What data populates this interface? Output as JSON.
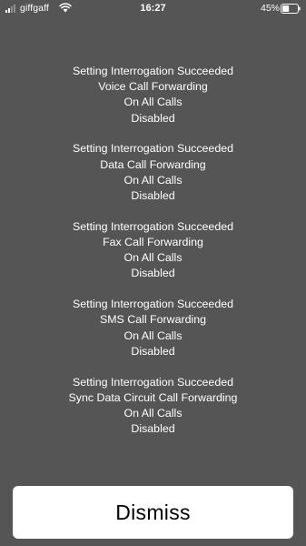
{
  "status_bar": {
    "carrier": "giffgaff",
    "time": "16:27",
    "battery_percent": "45%",
    "signal_bars": 2,
    "signal_max": 4,
    "battery_level": 0.45
  },
  "message_blocks": [
    {
      "status": "Setting Interrogation Succeeded",
      "service": "Voice Call Forwarding",
      "condition": "On All Calls",
      "state": "Disabled"
    },
    {
      "status": "Setting Interrogation Succeeded",
      "service": "Data Call Forwarding",
      "condition": "On All Calls",
      "state": "Disabled"
    },
    {
      "status": "Setting Interrogation Succeeded",
      "service": "Fax Call Forwarding",
      "condition": "On All Calls",
      "state": "Disabled"
    },
    {
      "status": "Setting Interrogation Succeeded",
      "service": "SMS Call Forwarding",
      "condition": "On All Calls",
      "state": "Disabled"
    },
    {
      "status": "Setting Interrogation Succeeded",
      "service": "Sync Data Circuit Call Forwarding",
      "condition": "On All Calls",
      "state": "Disabled"
    }
  ],
  "dismiss_label": "Dismiss",
  "icons": {
    "signal": "signal-icon",
    "wifi": "wifi-icon",
    "battery": "battery-icon"
  },
  "colors": {
    "background": "#555555",
    "text": "#ffffff",
    "button_background": "#ffffff",
    "button_text": "#000000"
  }
}
